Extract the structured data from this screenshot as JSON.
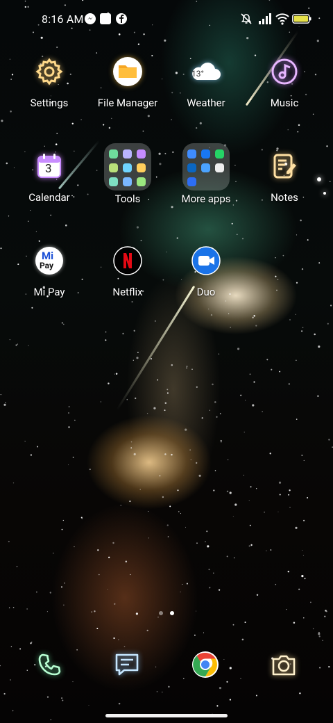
{
  "status_bar": {
    "time": "8:16 AM",
    "notification_icons": [
      "messenger-icon",
      "square-icon",
      "facebook-icon"
    ],
    "system_icons": [
      "mute-icon",
      "signal-icon",
      "wifi-icon",
      "battery-icon"
    ],
    "battery_color": "#e6e14a"
  },
  "apps": {
    "settings": "Settings",
    "file_manager": "File Manager",
    "weather": "Weather",
    "weather_temp": "13°",
    "music": "Music",
    "calendar": "Calendar",
    "calendar_day": "3",
    "tools": "Tools",
    "more_apps": "More apps",
    "notes": "Notes",
    "mi_pay": "Mi Pay",
    "netflix": "Netflix",
    "duo": "Duo"
  },
  "mi_pay_text": {
    "mi": "Mi",
    "pay": "Pay"
  },
  "page_indicator": {
    "pages": 2,
    "current": 2
  },
  "dock": [
    "phone-icon",
    "messages-icon",
    "chrome-icon",
    "camera-icon"
  ]
}
